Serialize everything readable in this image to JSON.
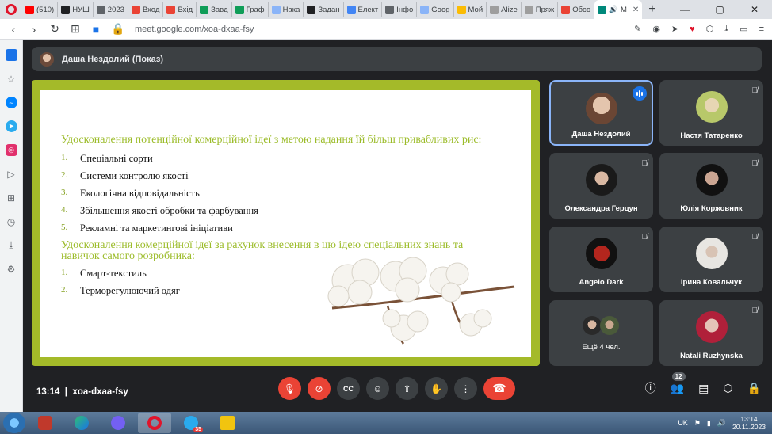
{
  "browser": {
    "tabs": [
      {
        "label": "(510)",
        "color": "#ff0000"
      },
      {
        "label": "НУШ",
        "color": "#202124"
      },
      {
        "label": "2023",
        "color": "#5f6368"
      },
      {
        "label": "Вход",
        "color": "#ea4335"
      },
      {
        "label": "Вхід",
        "color": "#ea4335"
      },
      {
        "label": "Завд",
        "color": "#0f9d58"
      },
      {
        "label": "Граф",
        "color": "#0f9d58"
      },
      {
        "label": "Нака",
        "color": "#8ab4f8"
      },
      {
        "label": "Задан",
        "color": "#202124"
      },
      {
        "label": "Елект",
        "color": "#4285f4"
      },
      {
        "label": "Інфо",
        "color": "#5f6368"
      },
      {
        "label": "Goog",
        "color": "#8ab4f8"
      },
      {
        "label": "Мой",
        "color": "#fbbc04"
      },
      {
        "label": "Alize",
        "color": "#9e9e9e"
      },
      {
        "label": "Пряж",
        "color": "#9e9e9e"
      },
      {
        "label": "Обсо",
        "color": "#ea4335"
      }
    ],
    "active_tab": "М",
    "url": "meet.google.com/xoa-dxaa-fsy"
  },
  "meet": {
    "presenter_label": "Даша Нездолий (Показ)",
    "slide": {
      "heading1": "Удосконалення потенційної комерційної ідеї з метою надання їй більш привабливих рис:",
      "list1": [
        {
          "num": "1.",
          "text": "Спеціальні сорти"
        },
        {
          "num": "2.",
          "text": "Системи контролю якості"
        },
        {
          "num": "3.",
          "text": "Екологічна відповідальність"
        },
        {
          "num": "4.",
          "text": "Збільшення якості обробки та фарбування"
        },
        {
          "num": "5.",
          "text": "Рекламні та маркетингові ініціативи"
        }
      ],
      "heading2_line1": "Удосконалення комерційної ідеї за рахунок внесення в цю ідею спеціальних знань та",
      "heading2_line2": "навичок самого розробника:",
      "list2": [
        {
          "num": "1.",
          "text": "Смарт-текстиль"
        },
        {
          "num": "2.",
          "text": "Терморегулюючий одяг"
        }
      ]
    },
    "participants": [
      {
        "name": "Даша Нездолий",
        "speaking": true
      },
      {
        "name": "Настя Татаренко",
        "speaking": false
      },
      {
        "name": "Олександра Герцун",
        "speaking": false
      },
      {
        "name": "Юлія Коржовник",
        "speaking": false
      },
      {
        "name": "Angelo Dark",
        "speaking": false
      },
      {
        "name": "Ірина Ковальчук",
        "speaking": false
      },
      {
        "name": "Ещё 4 чел.",
        "speaking": false
      },
      {
        "name": "Natali Ruzhynska",
        "speaking": false
      }
    ],
    "time": "13:14",
    "meeting_code": "xoa-dxaa-fsy",
    "people_count": "12"
  },
  "taskbar": {
    "lang": "UK",
    "clock_time": "13:14",
    "clock_date": "20.11.2023",
    "telegram_badge": "35"
  },
  "colors": {
    "slide_frame": "#a4ba29",
    "heading_green": "#9cbc2a",
    "danger_red": "#ea4335",
    "speaking_blue": "#1a73e8"
  }
}
